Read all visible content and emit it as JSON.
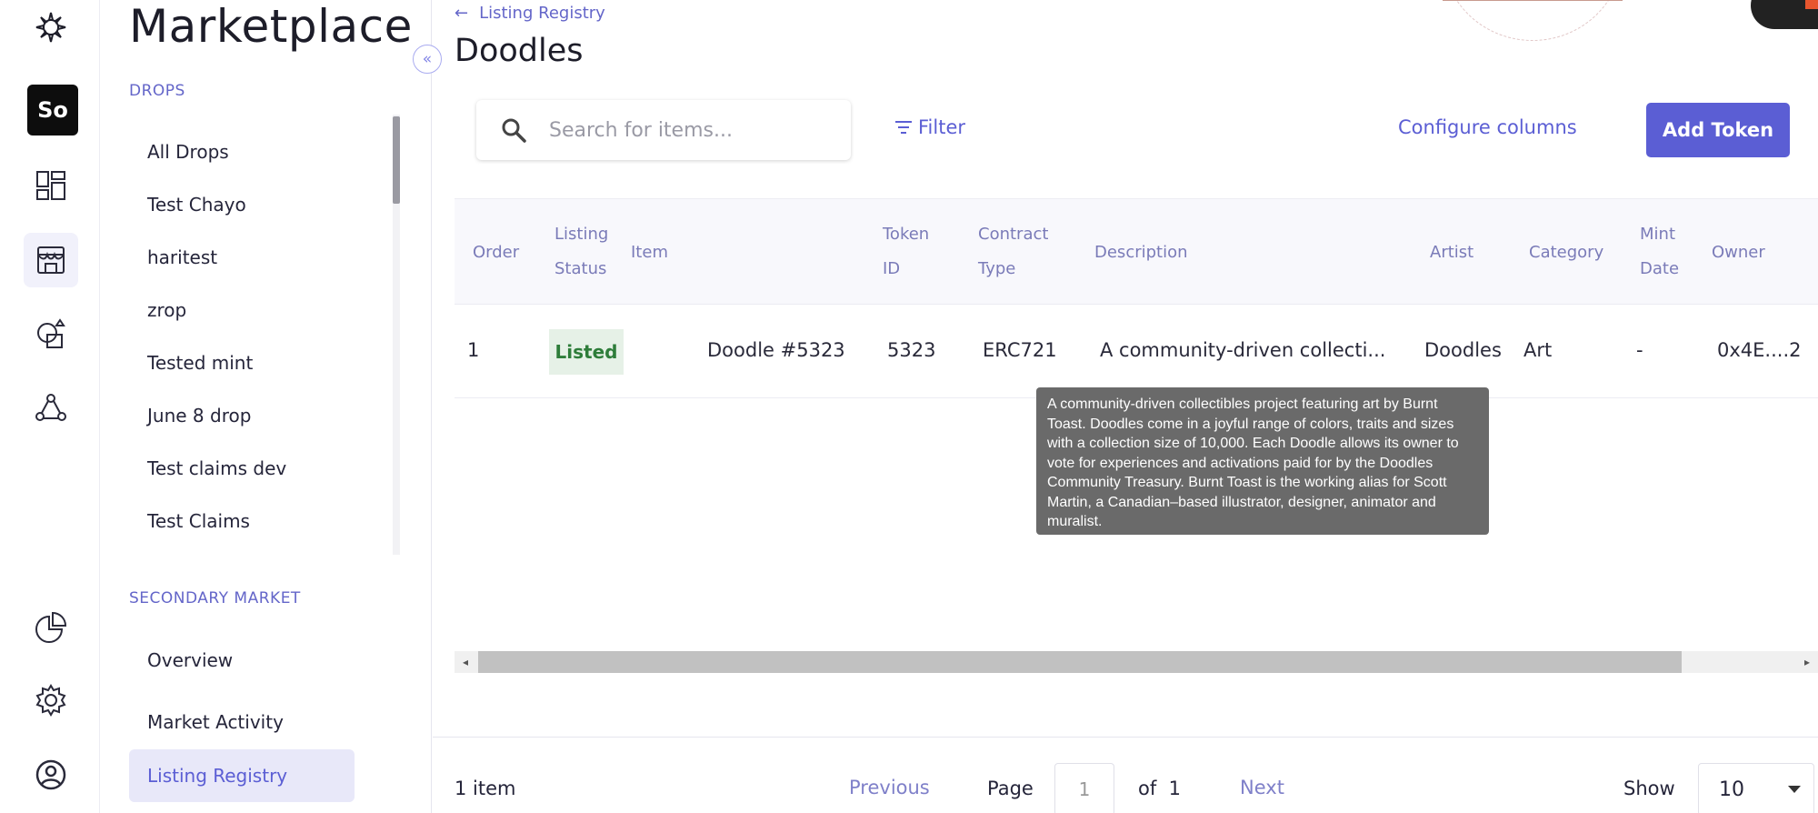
{
  "colors": {
    "accent": "#5b5ed4",
    "status_listed_bg": "#e6f1e7",
    "status_listed_fg": "#2e7d3a"
  },
  "rail": {
    "items": [
      {
        "icon": "logo-icon"
      },
      {
        "icon": "so-badge",
        "label": "So"
      },
      {
        "icon": "dashboard-icon"
      },
      {
        "icon": "storefront-icon",
        "active": true
      },
      {
        "icon": "shapes-icon"
      },
      {
        "icon": "network-icon"
      },
      {
        "icon": "pie-chart-icon"
      },
      {
        "icon": "gear-icon"
      },
      {
        "icon": "user-circle-icon"
      }
    ]
  },
  "sidebar": {
    "title": "Marketplace",
    "drops_label": "DROPS",
    "drops": [
      "All Drops",
      "Test Chayo",
      "haritest",
      "zrop",
      "Tested mint",
      "June 8 drop",
      "Test claims dev",
      "Test Claims"
    ],
    "secondary_label": "SECONDARY MARKET",
    "secondary": [
      "Overview",
      "Market Activity",
      "Listing Registry"
    ],
    "collapse_glyph": "«"
  },
  "header": {
    "back_glyph": "←",
    "breadcrumb": "Listing Registry",
    "title": "Doodles"
  },
  "toolbar": {
    "search_placeholder": "Search for items...",
    "filter_label": "Filter",
    "configure_label": "Configure columns",
    "add_label": "Add Token"
  },
  "table": {
    "headers": {
      "order": "Order",
      "listing_status_1": "Listing",
      "listing_status_2": "Status",
      "item": "Item",
      "token_id_1": "Token",
      "token_id_2": "ID",
      "contract_type_1": "Contract",
      "contract_type_2": "Type",
      "description": "Description",
      "artist": "Artist",
      "category": "Category",
      "mint_date_1": "Mint",
      "mint_date_2": "Date",
      "owner": "Owner"
    },
    "rows": [
      {
        "order": "1",
        "status": "Listed",
        "item": "Doodle #5323",
        "token_id": "5323",
        "contract_type": "ERC721",
        "description": "A community-driven collecti...",
        "artist": "Doodles",
        "category": "Art",
        "mint_date": "-",
        "owner": "0x4E....2"
      }
    ],
    "tooltip": "A community-driven collectibles project featuring art by Burnt Toast. Doodles come in a joyful range of colors, traits and sizes with a collection size of 10,000. Each Doodle allows its owner to vote for experiences and activations paid for by the Doodles Community Treasury. Burnt Toast is the working alias for Scott Martin, a Canadian–based illustrator, designer, animator and muralist."
  },
  "pagination": {
    "items_count": "1 item",
    "previous_label": "Previous",
    "page_label": "Page",
    "page_value": "1",
    "of_label": "of",
    "total_pages": "1",
    "next_label": "Next",
    "show_label": "Show",
    "show_value": "10"
  }
}
